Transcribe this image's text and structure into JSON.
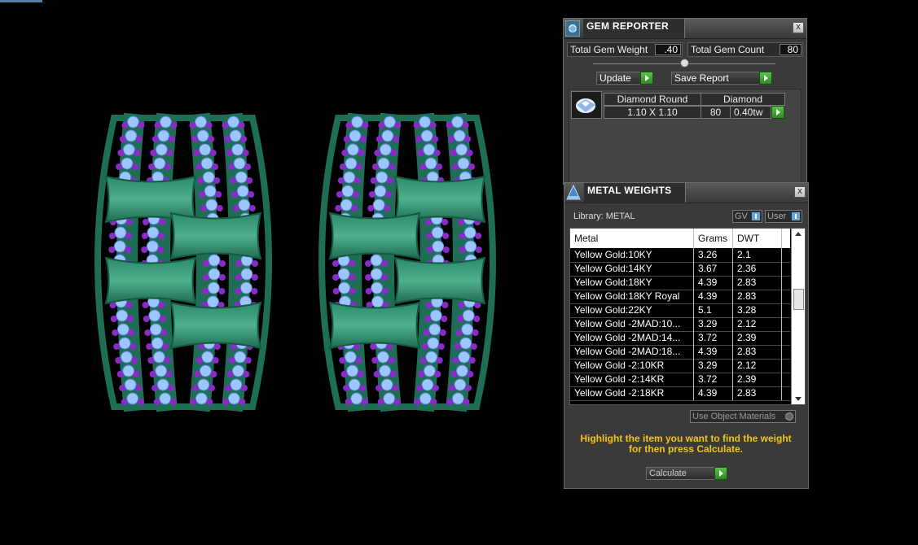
{
  "gem_reporter": {
    "title": "GEM REPORTER",
    "close": "x",
    "total_weight_label": "Total Gem Weight",
    "total_weight_value": ".40",
    "total_count_label": "Total Gem Count",
    "total_count_value": "80",
    "update_label": "Update",
    "save_report_label": "Save Report",
    "gem": {
      "name": "Diamond Round",
      "material": "Diamond",
      "size": "1.10 X 1.10",
      "count": "80",
      "weight": "0.40tw"
    }
  },
  "metal_weights": {
    "title": "METAL WEIGHTS",
    "close": "x",
    "library_label": "Library: METAL",
    "gv_label": "GV",
    "user_label": "User",
    "columns": [
      "Metal",
      "Grams",
      "DWT"
    ],
    "rows": [
      {
        "metal": "Yellow Gold:10KY",
        "grams": "3.26",
        "dwt": "2.1"
      },
      {
        "metal": "Yellow Gold:14KY",
        "grams": "3.67",
        "dwt": "2.36"
      },
      {
        "metal": "Yellow Gold:18KY",
        "grams": "4.39",
        "dwt": "2.83"
      },
      {
        "metal": "Yellow Gold:18KY Royal",
        "grams": "4.39",
        "dwt": "2.83"
      },
      {
        "metal": "Yellow Gold:22KY",
        "grams": "5.1",
        "dwt": "3.28"
      },
      {
        "metal": "Yellow Gold -2MAD:10...",
        "grams": "3.29",
        "dwt": "2.12"
      },
      {
        "metal": "Yellow Gold -2MAD:14...",
        "grams": "3.72",
        "dwt": "2.39"
      },
      {
        "metal": "Yellow Gold -2MAD:18...",
        "grams": "4.39",
        "dwt": "2.83"
      },
      {
        "metal": "Yellow Gold -2:10KR",
        "grams": "3.29",
        "dwt": "2.12"
      },
      {
        "metal": "Yellow Gold -2:14KR",
        "grams": "3.72",
        "dwt": "2.39"
      },
      {
        "metal": "Yellow Gold -2:18KR",
        "grams": "4.39",
        "dwt": "2.83"
      }
    ],
    "use_object_materials_label": "Use Object Materials",
    "hint": "Highlight the item you want to find the weight for then press Calculate.",
    "calculate_label": "Calculate"
  }
}
